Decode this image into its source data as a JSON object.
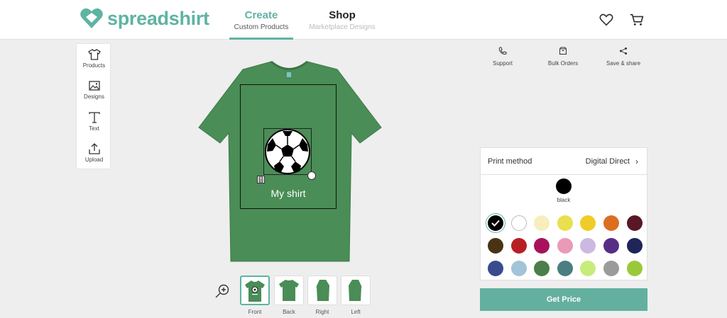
{
  "brand": {
    "name": "spreadshirt",
    "color": "#5fb3a3"
  },
  "nav": {
    "create": {
      "title": "Create",
      "subtitle": "Custom Products"
    },
    "shop": {
      "title": "Shop",
      "subtitle": "Marketplace Designs"
    }
  },
  "header_icons": [
    "heart-icon",
    "cart-icon"
  ],
  "toolbar": {
    "products": "Products",
    "designs": "Designs",
    "text": "Text",
    "upload": "Upload"
  },
  "product": {
    "shirt_color": "#4a8d56",
    "text": "My shirt",
    "design": "soccer-ball"
  },
  "views": {
    "front": "Front",
    "back": "Back",
    "right": "Right",
    "left": "Left",
    "active": "Front"
  },
  "actions": {
    "support": "Support",
    "bulk_orders": "Bulk Orders",
    "save_share": "Save & share"
  },
  "panel": {
    "print_method_label": "Print method",
    "print_method_value": "Digital Direct",
    "selected_color_name": "black",
    "selected_color": "#000000",
    "swatches": [
      "#000000",
      "#ffffff",
      "#f8edbc",
      "#e9df4f",
      "#f0cc28",
      "#dc6e22",
      "#5a1726",
      "#4a3315",
      "#b81f24",
      "#a8125a",
      "#e99ab6",
      "#cbb9e1",
      "#572d86",
      "#1f2459",
      "#394b8f",
      "#a3c3d8",
      "#4b7e48",
      "#4a7e80",
      "#c8ec7c",
      "#9a9c9a",
      "#99c93a"
    ]
  },
  "cta": {
    "get_price": "Get Price"
  }
}
